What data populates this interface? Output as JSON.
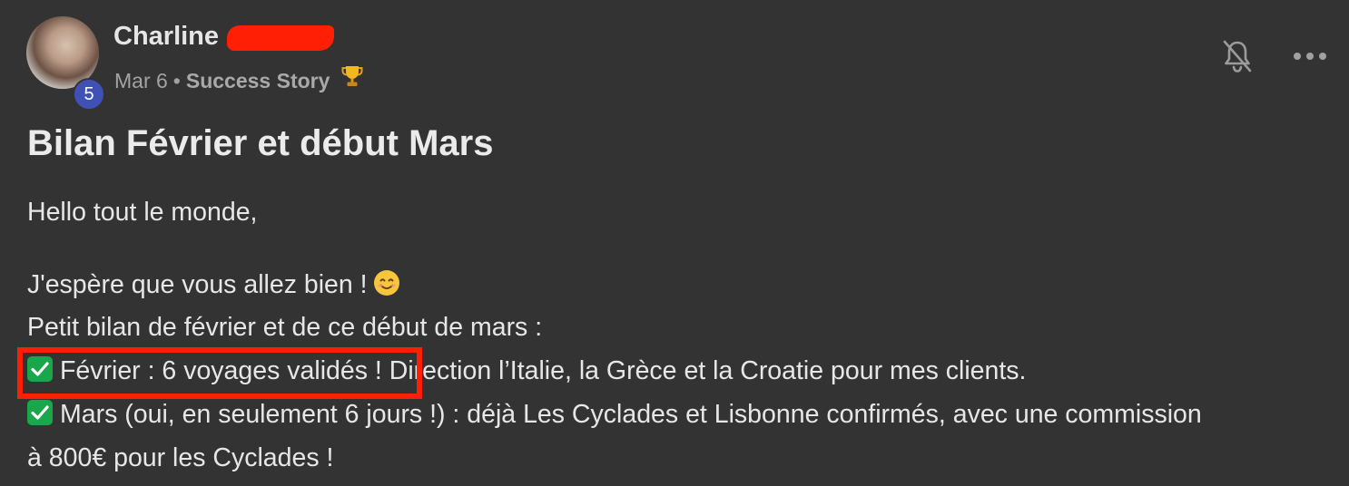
{
  "author": {
    "name": "Charline",
    "level": "5"
  },
  "meta": {
    "date": "Mar 6",
    "separator": "•",
    "category": "Success Story",
    "category_icon": "trophy-icon"
  },
  "actions": {
    "notifications_icon": "bell-off-icon",
    "more_icon": "more-icon"
  },
  "post": {
    "title": "Bilan Février et début Mars",
    "greeting": "Hello tout le monde,",
    "line1": "J'espère que vous allez bien !",
    "line1_emoji": "smiling-face-icon",
    "line2": "Petit bilan de février et de ce début de mars :",
    "bullet1_highlight": "Février : 6 voyages validés !",
    "bullet1_rest": " Direction l’Italie, la Grèce et la Croatie pour mes clients.",
    "bullet2_part1": "Mars (oui, en seulement 6 jours !) : déjà Les Cyclades et Lisbonne confirmés, avec une commission",
    "bullet2_part2": "à 800€ pour les Cyclades !"
  },
  "colors": {
    "background": "#333333",
    "text": "#e7e7e7",
    "muted": "#a3a3a3",
    "badge": "#3f51b5",
    "annotation_red": "#ff1f05",
    "check_green": "#1aa64a"
  }
}
